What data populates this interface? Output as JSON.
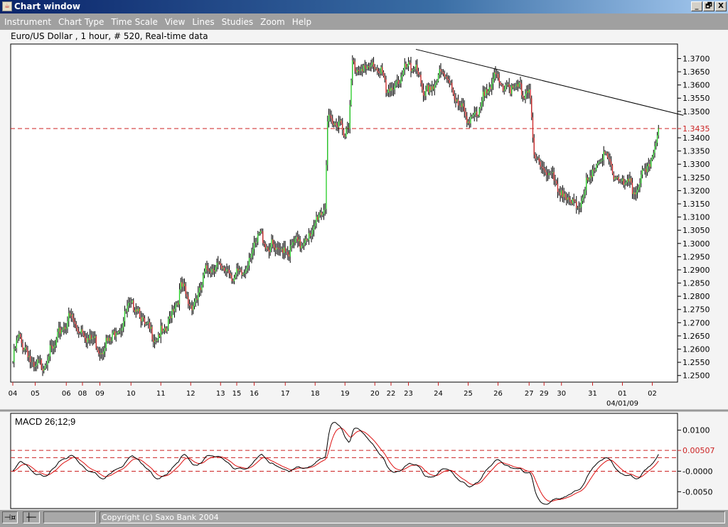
{
  "window": {
    "title": "Chart window",
    "minimize": "_",
    "restore": "🗗",
    "close": "X"
  },
  "menu": [
    "Instrument",
    "Chart Type",
    "Time Scale",
    "View",
    "Lines",
    "Studies",
    "Zoom",
    "Help"
  ],
  "info": "Euro/US Dollar , 1 hour, # 520, Real-time data",
  "colors": {
    "up": "#22cc22",
    "down": "#cc2222",
    "hline": "#cc2222",
    "macd": "#000000",
    "signal": "#dd1111"
  },
  "chart_data": {
    "type": "ohlc",
    "instrument": "Euro/US Dollar",
    "bars": 520,
    "ylim": [
      1.2475,
      1.3755
    ],
    "yticks": [
      "1.3700",
      "1.3650",
      "1.3600",
      "1.3550",
      "1.3500",
      "1.3400",
      "1.3350",
      "1.3300",
      "1.3250",
      "1.3200",
      "1.3150",
      "1.3100",
      "1.3050",
      "1.3000",
      "1.2950",
      "1.2900",
      "1.2850",
      "1.2800",
      "1.2750",
      "1.2700",
      "1.2650",
      "1.2600",
      "1.2550",
      "1.2500"
    ],
    "horizontal_line": {
      "value": 1.3435,
      "label": "1.3435"
    },
    "trendline": {
      "from": [
        324,
        1.3735
      ],
      "to": [
        539,
        1.3485
      ]
    },
    "xticks": [
      {
        "bar": 0,
        "label": "04"
      },
      {
        "bar": 18,
        "label": "05"
      },
      {
        "bar": 43,
        "label": "06"
      },
      {
        "bar": 56,
        "label": "08"
      },
      {
        "bar": 70,
        "label": "09"
      },
      {
        "bar": 95,
        "label": "10"
      },
      {
        "bar": 119,
        "label": "11"
      },
      {
        "bar": 143,
        "label": "12"
      },
      {
        "bar": 167,
        "label": "13"
      },
      {
        "bar": 180,
        "label": "15"
      },
      {
        "bar": 194,
        "label": "16"
      },
      {
        "bar": 219,
        "label": "17"
      },
      {
        "bar": 243,
        "label": "18"
      },
      {
        "bar": 267,
        "label": "19"
      },
      {
        "bar": 291,
        "label": "20"
      },
      {
        "bar": 304,
        "label": "22"
      },
      {
        "bar": 318,
        "label": "23"
      },
      {
        "bar": 342,
        "label": "24"
      },
      {
        "bar": 366,
        "label": "25"
      },
      {
        "bar": 390,
        "label": "26"
      },
      {
        "bar": 415,
        "label": "27"
      },
      {
        "bar": 427,
        "label": "29"
      },
      {
        "bar": 441,
        "label": "30"
      },
      {
        "bar": 466,
        "label": "31"
      },
      {
        "bar": 490,
        "label": "01"
      },
      {
        "bar": 514,
        "label": "02"
      }
    ],
    "date_label": "04/01/09",
    "close_path": [
      [
        0,
        1.255
      ],
      [
        5,
        1.265
      ],
      [
        18,
        1.252
      ],
      [
        30,
        1.258
      ],
      [
        44,
        1.272
      ],
      [
        57,
        1.266
      ],
      [
        72,
        1.26
      ],
      [
        85,
        1.268
      ],
      [
        97,
        1.278
      ],
      [
        110,
        1.266
      ],
      [
        121,
        1.265
      ],
      [
        135,
        1.283
      ],
      [
        145,
        1.276
      ],
      [
        158,
        1.292
      ],
      [
        170,
        1.29
      ],
      [
        183,
        1.287
      ],
      [
        198,
        1.303
      ],
      [
        210,
        1.297
      ],
      [
        222,
        1.298
      ],
      [
        240,
        1.303
      ],
      [
        247,
        1.312
      ],
      [
        251,
        1.315
      ],
      [
        253,
        1.345
      ],
      [
        262,
        1.346
      ],
      [
        270,
        1.342
      ],
      [
        273,
        1.368
      ],
      [
        282,
        1.366
      ],
      [
        296,
        1.367
      ],
      [
        300,
        1.356
      ],
      [
        315,
        1.365
      ],
      [
        324,
        1.368
      ],
      [
        330,
        1.355
      ],
      [
        340,
        1.362
      ],
      [
        349,
        1.364
      ],
      [
        360,
        1.35
      ],
      [
        373,
        1.347
      ],
      [
        383,
        1.362
      ],
      [
        397,
        1.36
      ],
      [
        405,
        1.358
      ],
      [
        415,
        1.358
      ],
      [
        419,
        1.333
      ],
      [
        430,
        1.327
      ],
      [
        440,
        1.32
      ],
      [
        452,
        1.313
      ],
      [
        474,
        1.334
      ],
      [
        485,
        1.325
      ],
      [
        499,
        1.32
      ],
      [
        510,
        1.328
      ],
      [
        514,
        1.332
      ],
      [
        519,
        1.347
      ]
    ]
  },
  "macd": {
    "label": "MACD 26;12;9",
    "ylim": [
      -0.0091,
      0.0141
    ],
    "yticks": [
      {
        "v": 0.01,
        "label": "0.0100"
      },
      {
        "v": 0,
        "label": "-0.0000"
      },
      {
        "v": -0.005,
        "label": "-0.0050"
      }
    ],
    "current": {
      "v": 0.00507,
      "label": "0.00507"
    },
    "dashed_levels": [
      0.00507,
      0.0033,
      0
    ]
  },
  "statusbar": {
    "copyright": "Copyright (c) Saxo Bank 2004"
  }
}
